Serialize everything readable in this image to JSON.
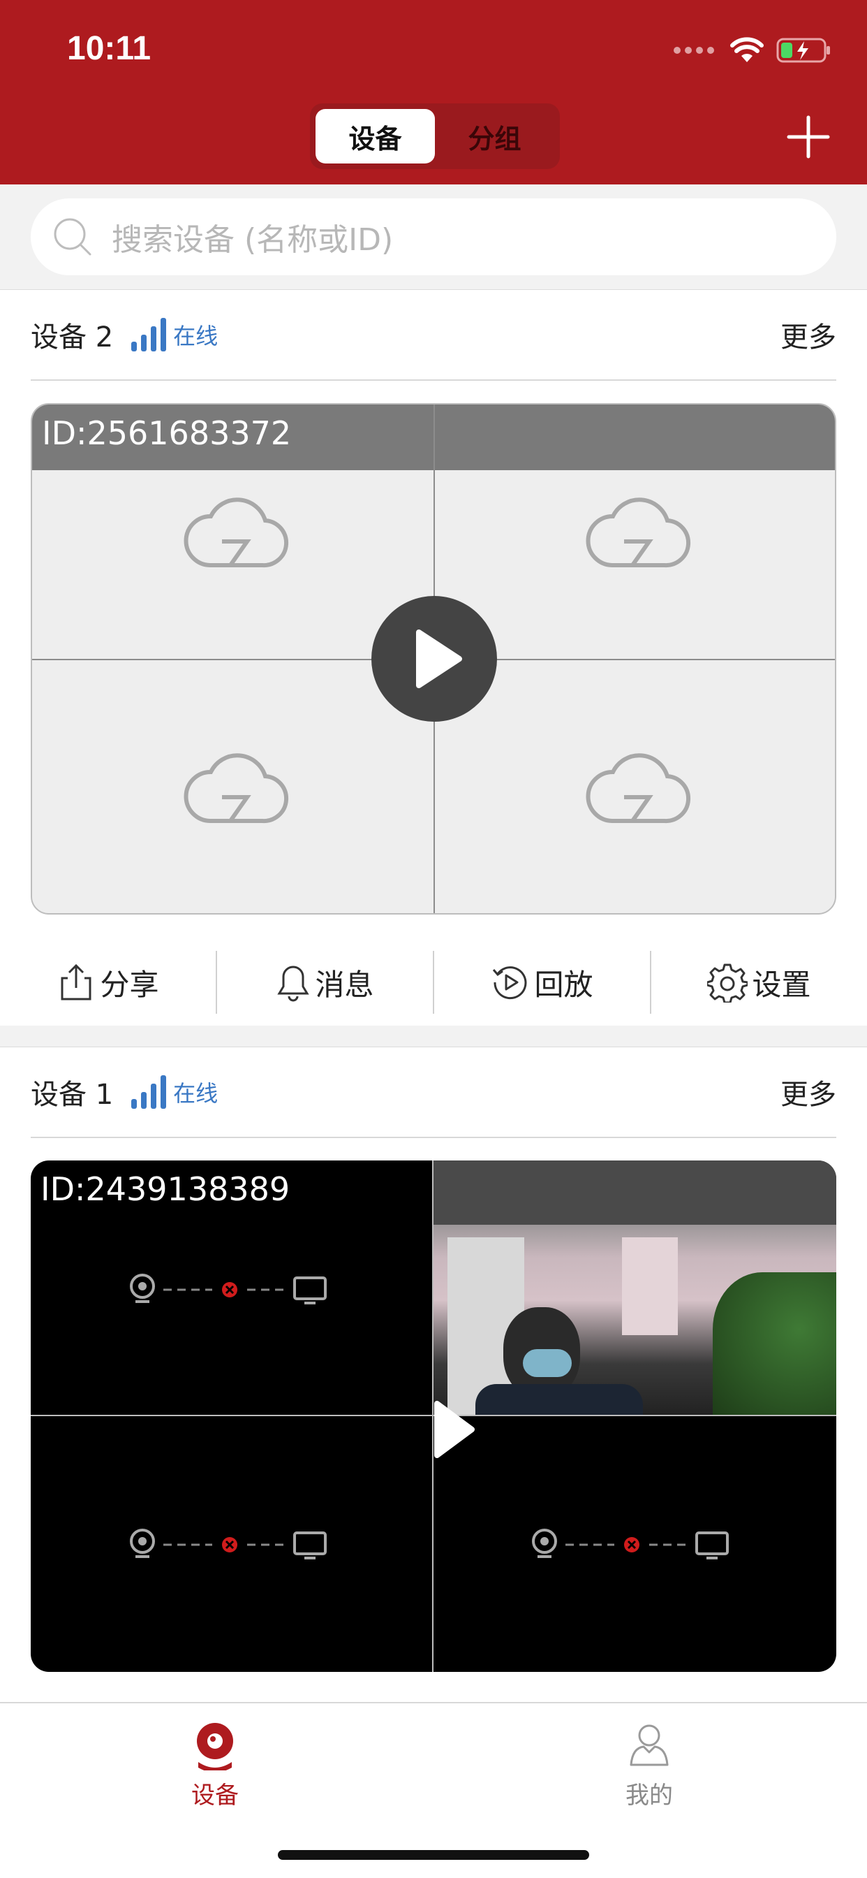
{
  "status": {
    "time": "10:11"
  },
  "header": {
    "tabs": [
      {
        "label": "设备",
        "active": true
      },
      {
        "label": "分组",
        "active": false
      }
    ]
  },
  "search": {
    "placeholder": "搜索设备 (名称或ID)"
  },
  "devices": [
    {
      "name": "设备 2",
      "status": "在线",
      "more": "更多",
      "id_label": "ID:2561683372",
      "actions": [
        "分享",
        "消息",
        "回放",
        "设置"
      ]
    },
    {
      "name": "设备 1",
      "status": "在线",
      "more": "更多",
      "id_label": "ID:2439138389"
    }
  ],
  "tabbar": {
    "items": [
      {
        "label": "设备",
        "active": true
      },
      {
        "label": "我的",
        "active": false
      }
    ]
  },
  "colors": {
    "brand": "#ae1b1f",
    "accent": "#3a78c4"
  }
}
